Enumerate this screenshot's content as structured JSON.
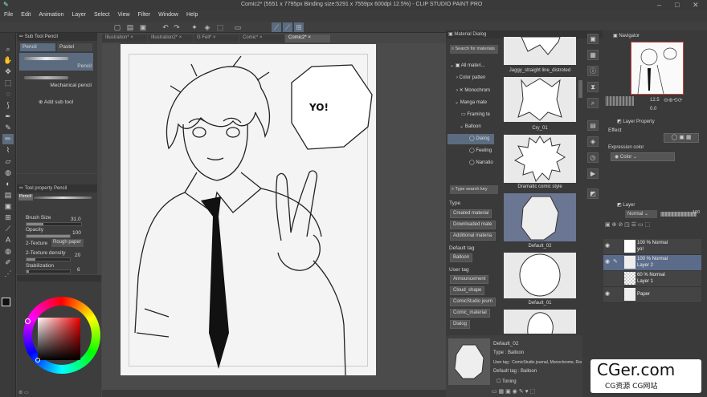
{
  "title": "Comic2* (5551 x 7795px Binding size:5291 x 7559px 600dpi 12.5%) - CLIP STUDIO PAINT PRO",
  "menu": [
    "File",
    "Edit",
    "Animation",
    "Layer",
    "Select",
    "View",
    "Filter",
    "Window",
    "Help"
  ],
  "doc_tabs": [
    "Illustration*",
    "Illustration2*",
    "G Fell*",
    "Comic*",
    "Comic2*"
  ],
  "subtool": {
    "header": "Sub Tool Pencil",
    "tabs": [
      "Pencil",
      "Pastel"
    ],
    "items": [
      "Pencil",
      "Mechanical pencil"
    ],
    "add": "Add sub tool"
  },
  "toolprop": {
    "header": "Tool property Pencil",
    "tag": "Pencil",
    "brush_size_label": "Brush Size",
    "brush_size": "31.0",
    "opacity_label": "Opacity",
    "opacity": "100",
    "texture_label": "2-Texture",
    "texture_value": "Rough paper",
    "density_label": "2-Texture density",
    "density": "20",
    "stabilization_label": "Stabilization",
    "stabilization": "6",
    "brush_size_level": 0.31,
    "opacity_level": 1.0,
    "density_level": 0.2,
    "stabilization_level": 0.06
  },
  "canvas": {
    "speech": "YO!"
  },
  "material": {
    "header": "Material Dialog",
    "search": "Search for materials",
    "tree": [
      "All materi...",
      "Color patten",
      "Monochrom",
      "Manga mate",
      "Framing te",
      "Balloon",
      "Dialog",
      "Feeling",
      "Narratio"
    ],
    "tag_search": "Type search key",
    "type_label": "Type",
    "type_tags": [
      "Created material",
      "Downloaded mate",
      "Additional materia"
    ],
    "default_tag_label": "Default tag",
    "default_tags": [
      "Balloon"
    ],
    "user_tag_label": "User tag",
    "user_tags": [
      "Announcement",
      "Cloud_shape",
      "ComicStudio journ",
      "Comic_material",
      "Dialog"
    ],
    "thumbs": [
      "Jaggy_straight line_distroted",
      "Cry_01",
      "Dramatic comic style",
      "Default_02",
      "Default_01"
    ],
    "detail": {
      "name": "Default_02",
      "type": "Type : Balloon",
      "usertag": "User tag : ComicStudio journal, Monochrome, Round",
      "deftag": "Default tag : Balloon",
      "toning": "Toning"
    }
  },
  "navigator": {
    "header": "Navigator",
    "zoom": "12.5",
    "angle": "0.0"
  },
  "layerprop": {
    "header": "Layer Property",
    "effect": "Effect",
    "expr_label": "Expression color",
    "expr_value": "Color"
  },
  "layers": {
    "header": "Layer",
    "blend": "Normal",
    "opacity": "100",
    "rows": [
      {
        "pct": "100 % Normal",
        "name": "yo!"
      },
      {
        "pct": "100 % Normal",
        "name": "Layer 2"
      },
      {
        "pct": "60 % Normal",
        "name": "Layer 1"
      },
      {
        "pct": "",
        "name": "Paper"
      }
    ]
  },
  "watermark": {
    "big": "CGer.com",
    "small": "CG资源 CG网站"
  },
  "colors": {
    "accent": "#5b6b80",
    "panel": "#3a3a3a"
  }
}
